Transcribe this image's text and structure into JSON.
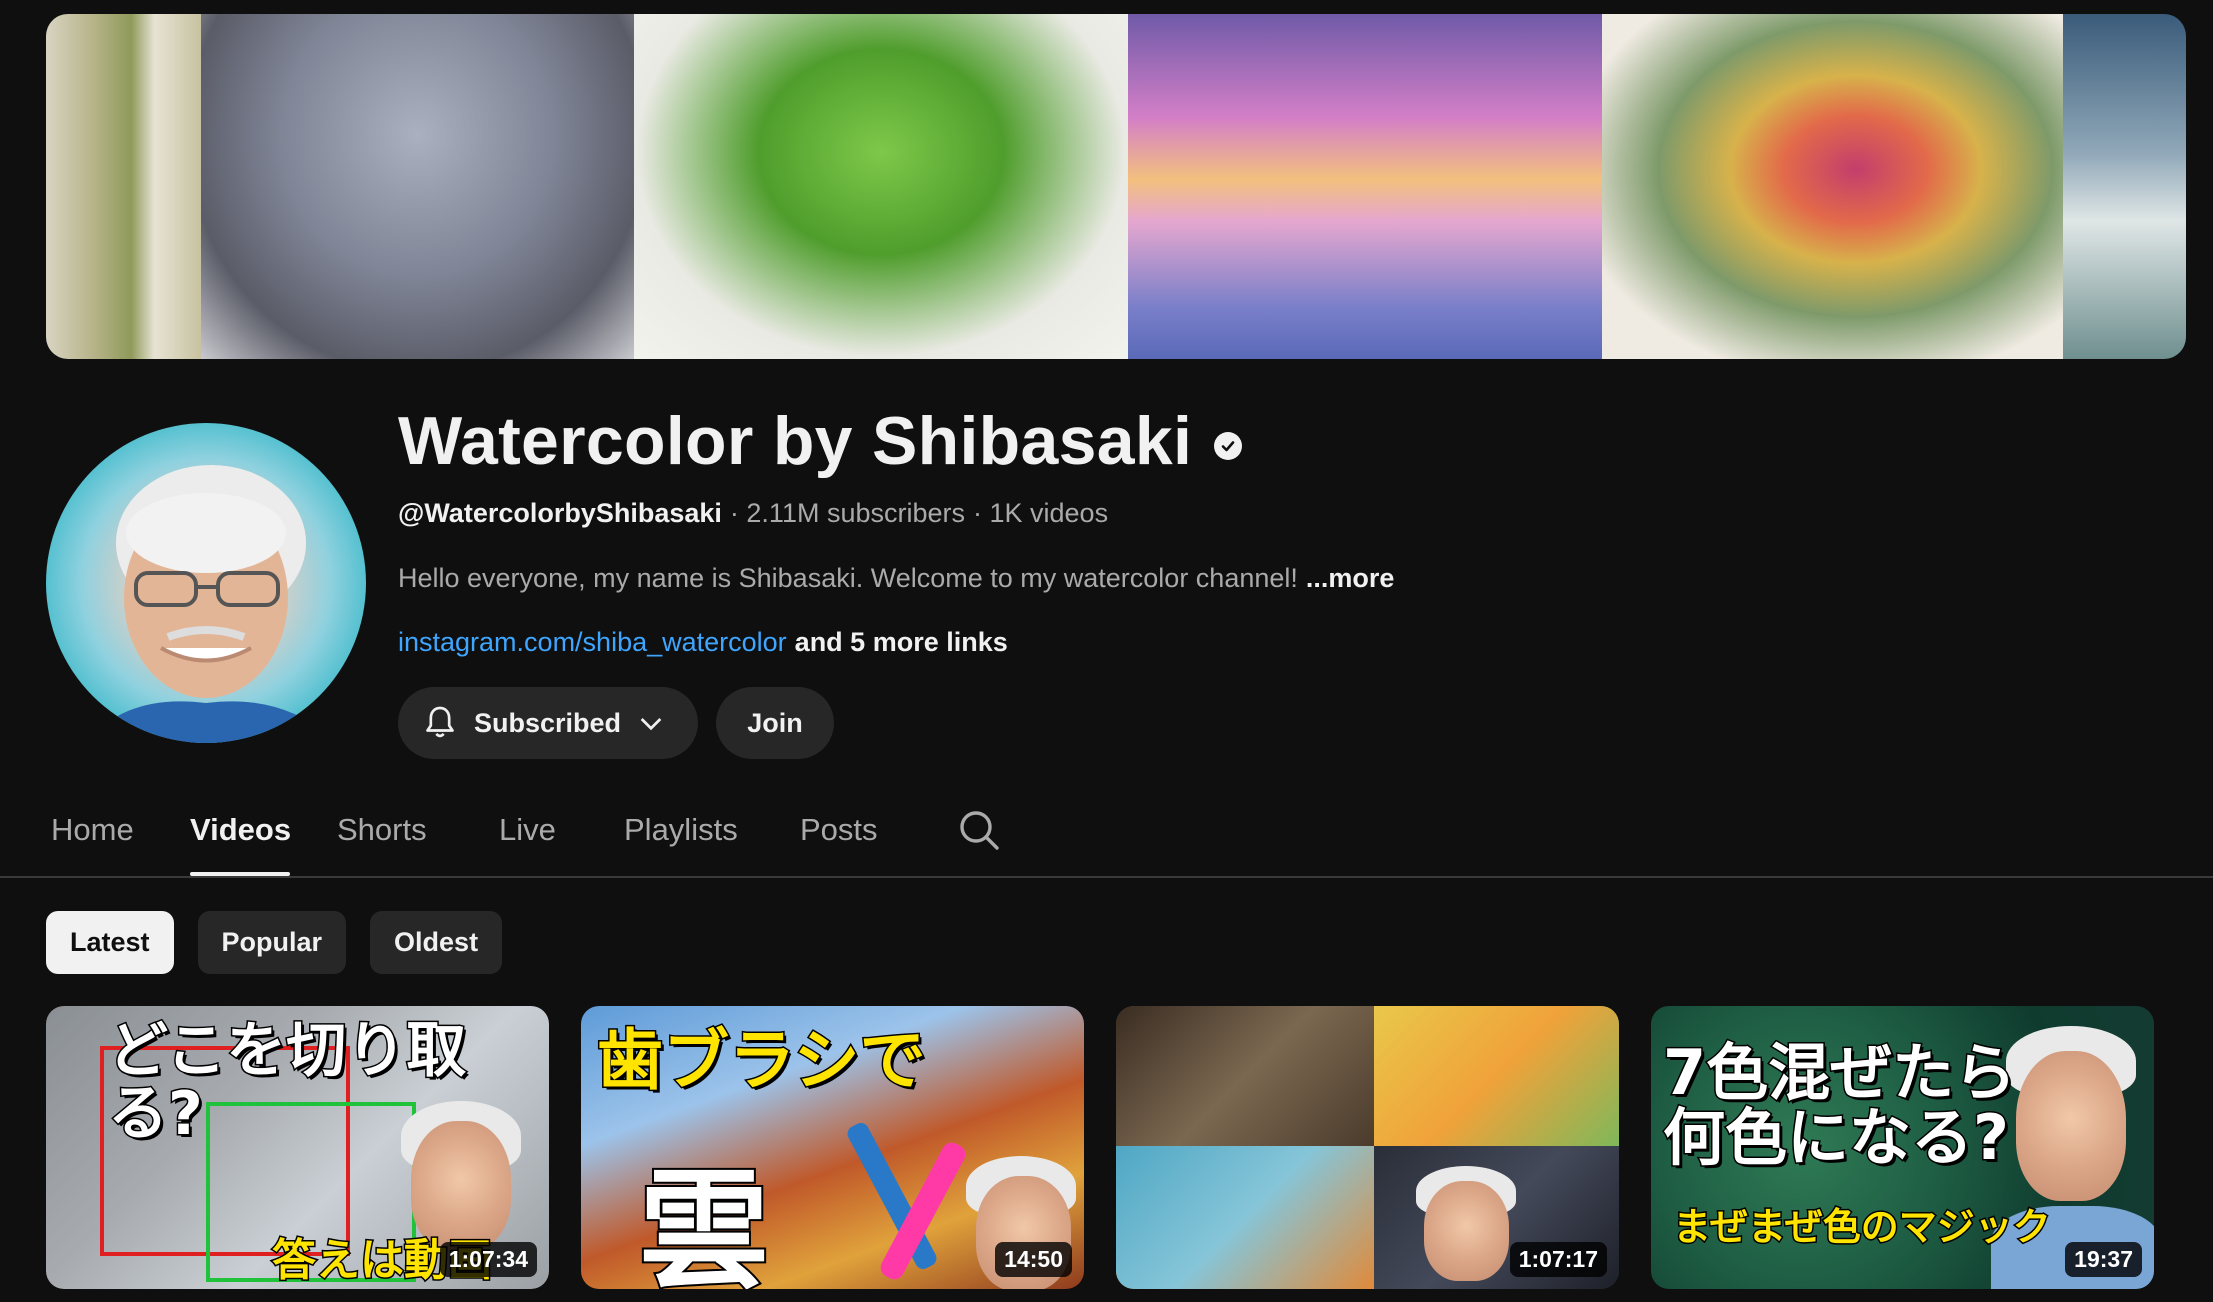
{
  "channel": {
    "name": "Watercolor by Shibasaki",
    "handle": "@WatercolorbyShibasaki",
    "subscribers": "· 2.11M subscribers",
    "videos": "· 1K videos",
    "description": "Hello everyone, my name is Shibasaki. Welcome to my watercolor channel!",
    "more_label": "...more",
    "link_text": "instagram.com/shiba_watercolor",
    "more_links": "and 5 more links",
    "subscribe_label": "Subscribed",
    "join_label": "Join"
  },
  "tabs": [
    {
      "label": "Home"
    },
    {
      "label": "Videos",
      "active": true
    },
    {
      "label": "Shorts"
    },
    {
      "label": "Live"
    },
    {
      "label": "Playlists"
    },
    {
      "label": "Posts"
    }
  ],
  "chips": [
    {
      "label": "Latest",
      "active": true
    },
    {
      "label": "Popular"
    },
    {
      "label": "Oldest"
    }
  ],
  "videos": [
    {
      "title_text": "どこを切り取る?",
      "sub_text": "答えは動画",
      "duration": "1:07:34"
    },
    {
      "title_text": "歯ブラシで",
      "sub_text": "雲",
      "duration": "14:50"
    },
    {
      "duration": "1:07:17"
    },
    {
      "title_text": "7色混ぜたら\n何色になる?",
      "sub_text": "まぜまぜ色のマジック",
      "duration": "19:37"
    }
  ],
  "icons": {
    "verified": "check-badge-icon",
    "bell": "bell-icon",
    "chevron": "chevron-down-icon",
    "search": "search-icon"
  },
  "colors": {
    "background": "#0f0f0f",
    "link": "#3ea6ff",
    "chip_bg": "#272727",
    "text_secondary": "#aaaaaa"
  }
}
